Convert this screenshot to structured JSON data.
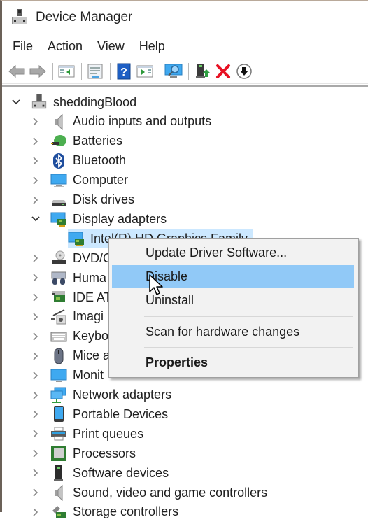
{
  "window": {
    "title": "Device Manager",
    "app_icon": "device-manager-icon"
  },
  "menubar": {
    "items": [
      "File",
      "Action",
      "View",
      "Help"
    ]
  },
  "toolbar": {
    "buttons": [
      {
        "name": "back",
        "icon": "back-arrow-icon",
        "enabled": false
      },
      {
        "name": "forward",
        "icon": "forward-arrow-icon",
        "enabled": false
      },
      {
        "name": "show-hide-console-tree",
        "icon": "console-tree-icon"
      },
      {
        "name": "properties",
        "icon": "properties-sheet-icon"
      },
      {
        "name": "help",
        "icon": "help-icon"
      },
      {
        "name": "show-action-pane",
        "icon": "action-pane-icon"
      },
      {
        "name": "scan-for-hardware-changes",
        "icon": "scan-hardware-icon"
      },
      {
        "name": "update-driver",
        "icon": "update-driver-icon"
      },
      {
        "name": "uninstall",
        "icon": "uninstall-x-icon"
      },
      {
        "name": "disable",
        "icon": "disable-down-arrow-icon"
      }
    ]
  },
  "tree": {
    "root": {
      "label": "sheddingBlood",
      "expanded": true
    },
    "categories": [
      {
        "label": "Audio inputs and outputs",
        "icon": "speaker-icon",
        "expanded": false
      },
      {
        "label": "Batteries",
        "icon": "battery-icon",
        "expanded": false
      },
      {
        "label": "Bluetooth",
        "icon": "bluetooth-icon",
        "expanded": false
      },
      {
        "label": "Computer",
        "icon": "computer-icon",
        "expanded": false
      },
      {
        "label": "Disk drives",
        "icon": "disk-drive-icon",
        "expanded": false
      },
      {
        "label": "Display adapters",
        "icon": "display-adapter-icon",
        "expanded": true,
        "children": [
          {
            "label": "Intel(R) HD Graphics Family",
            "icon": "display-adapter-icon",
            "selected": true
          }
        ]
      },
      {
        "label": "DVD/CD-ROM drives",
        "visible_label": "DVD/C",
        "icon": "dvd-drive-icon",
        "expanded": false
      },
      {
        "label": "Human Interface Devices",
        "visible_label": "Huma",
        "icon": "hid-icon",
        "expanded": false
      },
      {
        "label": "IDE ATA/ATAPI controllers",
        "visible_label": "IDE AT",
        "icon": "ide-controller-icon",
        "expanded": false
      },
      {
        "label": "Imaging devices",
        "visible_label": "Imagi",
        "icon": "imaging-icon",
        "expanded": false
      },
      {
        "label": "Keyboards",
        "visible_label": "Keybo",
        "icon": "keyboard-icon",
        "expanded": false
      },
      {
        "label": "Mice and other pointing devices",
        "visible_label": "Mice a",
        "icon": "mouse-icon",
        "expanded": false
      },
      {
        "label": "Monitors",
        "visible_label": "Monit",
        "icon": "monitor-icon",
        "expanded": false
      },
      {
        "label": "Network adapters",
        "icon": "network-icon",
        "expanded": false
      },
      {
        "label": "Portable Devices",
        "icon": "portable-device-icon",
        "expanded": false
      },
      {
        "label": "Print queues",
        "icon": "printer-icon",
        "expanded": false
      },
      {
        "label": "Processors",
        "icon": "processor-icon",
        "expanded": false
      },
      {
        "label": "Software devices",
        "icon": "software-device-icon",
        "expanded": false
      },
      {
        "label": "Sound, video and game controllers",
        "icon": "speaker-icon",
        "expanded": false
      },
      {
        "label": "Storage controllers",
        "icon": "storage-controller-icon",
        "expanded": false
      }
    ]
  },
  "context_menu": {
    "items": [
      {
        "label": "Update Driver Software...",
        "hover": false,
        "bold": false
      },
      {
        "label": "Disable",
        "hover": true,
        "bold": false
      },
      {
        "label": "Uninstall",
        "hover": false,
        "bold": false
      },
      {
        "label": "Scan for hardware changes",
        "hover": false,
        "bold": false
      },
      {
        "label": "Properties",
        "hover": false,
        "bold": true
      }
    ]
  },
  "colors": {
    "selection": "#cce8ff",
    "menu_hover": "#91c9f7",
    "menu_bg": "#f2f2f2",
    "uninstall_red": "#e81123"
  }
}
